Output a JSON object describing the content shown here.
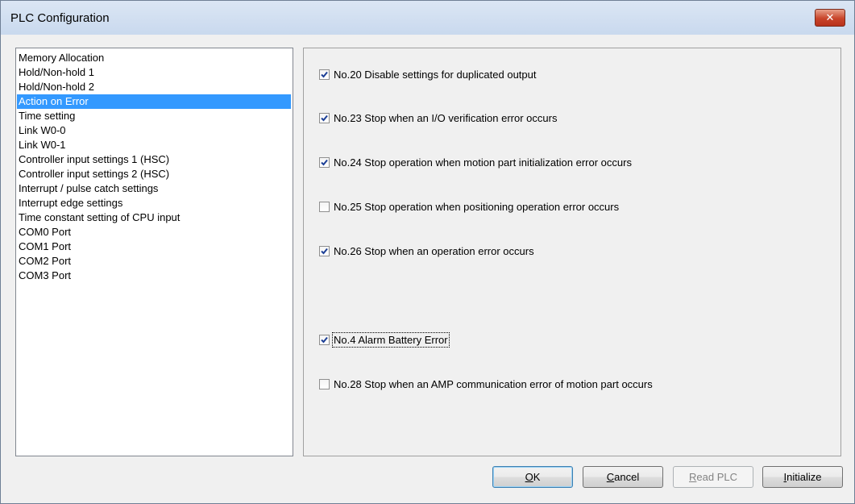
{
  "window": {
    "title": "PLC Configuration",
    "close_glyph": "✕"
  },
  "sidebar": {
    "items": [
      {
        "label": "Memory Allocation"
      },
      {
        "label": "Hold/Non-hold 1"
      },
      {
        "label": "Hold/Non-hold 2"
      },
      {
        "label": "Action on Error",
        "selected": true
      },
      {
        "label": "Time setting"
      },
      {
        "label": "Link W0-0"
      },
      {
        "label": "Link W0-1"
      },
      {
        "label": "Controller input settings 1 (HSC)"
      },
      {
        "label": "Controller input settings 2 (HSC)"
      },
      {
        "label": "Interrupt / pulse catch settings"
      },
      {
        "label": "Interrupt edge settings"
      },
      {
        "label": "Time constant setting of CPU input"
      },
      {
        "label": "COM0 Port"
      },
      {
        "label": "COM1 Port"
      },
      {
        "label": "COM2 Port"
      },
      {
        "label": "COM3 Port"
      }
    ]
  },
  "options": [
    {
      "label": "No.20 Disable settings for duplicated output",
      "checked": true
    },
    {
      "label": "No.23 Stop when an I/O verification error occurs",
      "checked": true
    },
    {
      "label": "No.24 Stop operation when motion part initialization error occurs",
      "checked": true
    },
    {
      "label": "No.25 Stop operation when positioning operation error occurs",
      "checked": false
    },
    {
      "label": "No.26 Stop when an operation error occurs",
      "checked": true
    },
    {
      "label": "No.4 Alarm Battery Error",
      "checked": true,
      "focused": true
    },
    {
      "label": "No.28 Stop when an AMP communication error of motion part occurs",
      "checked": false
    }
  ],
  "buttons": {
    "ok": {
      "label": "OK",
      "mnemonic_char": "O",
      "rest": "K"
    },
    "cancel": {
      "label": "Cancel",
      "mnemonic_char": "C",
      "rest": "ancel"
    },
    "read_plc": {
      "label": "Read PLC",
      "mnemonic_char": "R",
      "rest": "ead PLC",
      "disabled": true
    },
    "initialize": {
      "label": "Initialize",
      "mnemonic_char": "I",
      "rest": "nitialize"
    }
  },
  "colors": {
    "selection": "#3399ff",
    "check": "#1c3f96",
    "close": "#c8442a"
  },
  "icons": {
    "close": "close-icon",
    "check": "checkmark-icon"
  }
}
